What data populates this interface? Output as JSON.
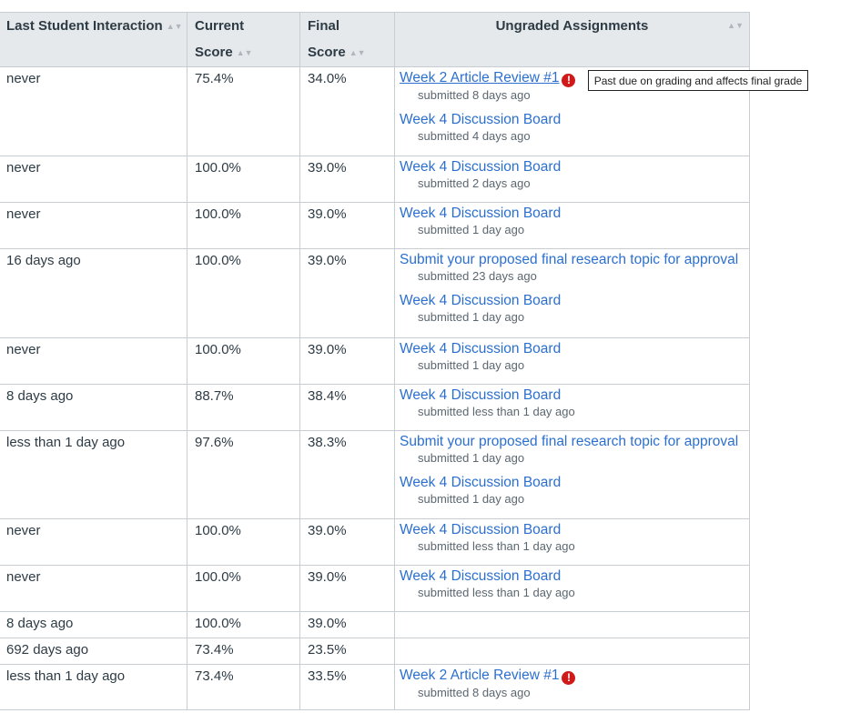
{
  "headers": {
    "last_interaction": "Last Student Interaction",
    "current_score": "Current Score",
    "final_score": "Final Score",
    "ungraded": "Ungraded Assignments"
  },
  "tooltip": "Past due on grading and affects final grade",
  "rows": [
    {
      "last": "never",
      "current": "75.4%",
      "final": "34.0%",
      "assignments": [
        {
          "title": "Week 2 Article Review #1",
          "sub": "submitted 8 days ago",
          "warn": true,
          "underline": true
        },
        {
          "title": "Week 4 Discussion Board",
          "sub": "submitted 4 days ago",
          "warn": false
        }
      ]
    },
    {
      "last": "never",
      "current": "100.0%",
      "final": "39.0%",
      "assignments": [
        {
          "title": "Week 4 Discussion Board",
          "sub": "submitted 2 days ago",
          "warn": false
        }
      ]
    },
    {
      "last": "never",
      "current": "100.0%",
      "final": "39.0%",
      "assignments": [
        {
          "title": "Week 4 Discussion Board",
          "sub": "submitted 1 day ago",
          "warn": false
        }
      ]
    },
    {
      "last": "16 days ago",
      "current": "100.0%",
      "final": "39.0%",
      "assignments": [
        {
          "title": "Submit your proposed final research topic for approval",
          "sub": "submitted 23 days ago",
          "warn": false
        },
        {
          "title": "Week 4 Discussion Board",
          "sub": "submitted 1 day ago",
          "warn": false
        }
      ]
    },
    {
      "last": "never",
      "current": "100.0%",
      "final": "39.0%",
      "assignments": [
        {
          "title": "Week 4 Discussion Board",
          "sub": "submitted 1 day ago",
          "warn": false
        }
      ]
    },
    {
      "last": "8 days ago",
      "current": "88.7%",
      "final": "38.4%",
      "assignments": [
        {
          "title": "Week 4 Discussion Board",
          "sub": "submitted less than 1 day ago",
          "warn": false
        }
      ]
    },
    {
      "last": "less than 1 day ago",
      "current": "97.6%",
      "final": "38.3%",
      "assignments": [
        {
          "title": "Submit your proposed final research topic for approval",
          "sub": "submitted 1 day ago",
          "warn": false
        },
        {
          "title": "Week 4 Discussion Board",
          "sub": "submitted 1 day ago",
          "warn": false
        }
      ]
    },
    {
      "last": "never",
      "current": "100.0%",
      "final": "39.0%",
      "assignments": [
        {
          "title": "Week 4 Discussion Board",
          "sub": "submitted less than 1 day ago",
          "warn": false
        }
      ]
    },
    {
      "last": "never",
      "current": "100.0%",
      "final": "39.0%",
      "assignments": [
        {
          "title": "Week 4 Discussion Board",
          "sub": "submitted less than 1 day ago",
          "warn": false
        }
      ]
    },
    {
      "last": "8 days ago",
      "current": "100.0%",
      "final": "39.0%",
      "assignments": []
    },
    {
      "last": "692 days ago",
      "current": "73.4%",
      "final": "23.5%",
      "assignments": []
    },
    {
      "last": "less than 1 day ago",
      "current": "73.4%",
      "final": "33.5%",
      "assignments": [
        {
          "title": "Week 2 Article Review #1",
          "sub": "submitted 8 days ago",
          "warn": true
        }
      ]
    }
  ]
}
